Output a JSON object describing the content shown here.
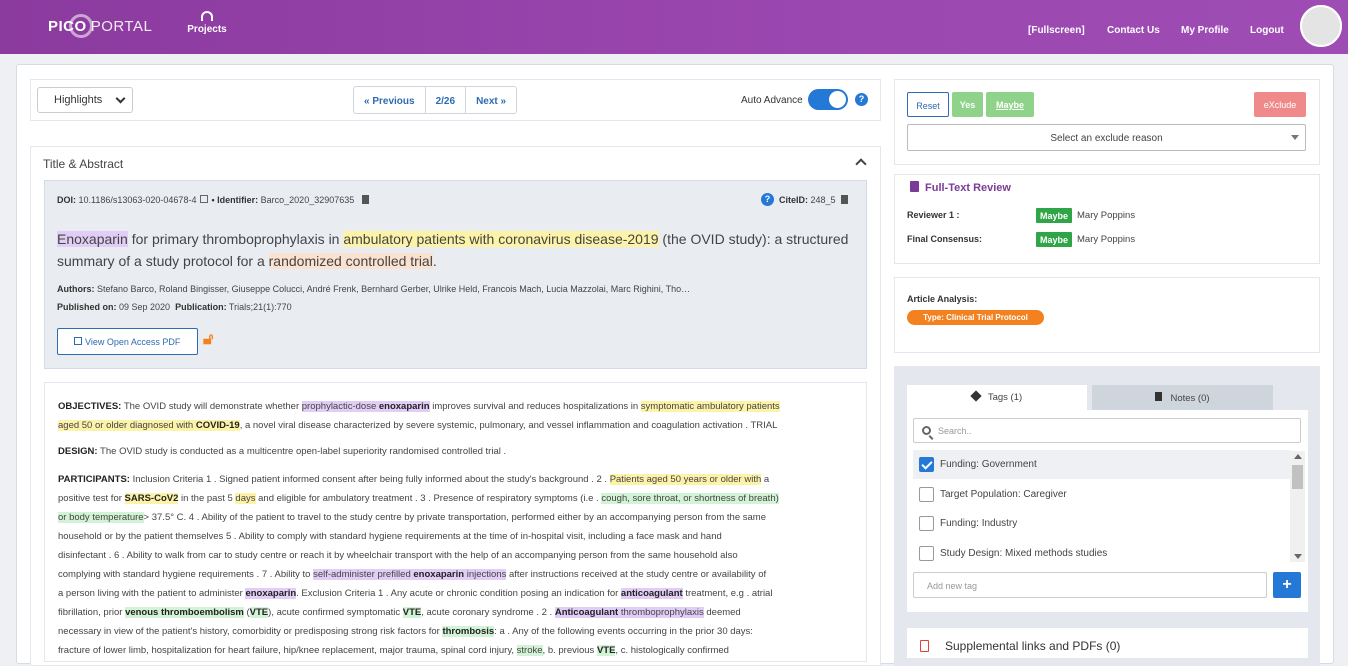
{
  "header": {
    "logo_bold": "PICO",
    "logo_light": "PORTAL",
    "projects": "Projects",
    "fullscreen": "[Fullscreen]",
    "contact": "Contact Us",
    "profile": "My Profile",
    "logout": "Logout"
  },
  "toolbar": {
    "view_select": "Highlights",
    "previous": "« Previous",
    "position": "2/26",
    "next": "Next »",
    "auto_advance": "Auto Advance"
  },
  "section": {
    "title": "Title & Abstract"
  },
  "meta": {
    "doi": "DOI:",
    "doi_value": "10.1186/s13063-020-04678-4",
    "identifier": "• Identifier:",
    "identifier_value": "Barco_2020_32907635",
    "cite_label": "CiteID:",
    "cite_value": "248_5",
    "authors_label": "Authors:",
    "authors": "Stefano Barco, Roland Bingisser, Giuseppe Colucci, André Frenk, Bernhard Gerber, Ulrike Held, Francois Mach, Lucia Mazzolai, Marc Righini, Tho…",
    "published_label": "Published on:",
    "published": "09 Sep 2020",
    "publication_label": "Publication:",
    "publication": "Trials;21(1):770",
    "pdf_button": "View Open Access PDF"
  },
  "title": {
    "t1": "Enoxaparin",
    "t2": " for primary thromboprophylaxis in ",
    "t3": "ambulatory patients",
    "t4": " with coronavirus disease-2019",
    "t5": " (the OVID study): a structured summary of a study protocol for a ",
    "t6": "randomized controlled trial",
    "t7": "."
  },
  "abstract": {
    "obj": {
      "label": "OBJECTIVES:",
      "a": " The OVID study will demonstrate whether ",
      "b": "prophylactic-dose ",
      "c": "enoxaparin",
      "d": " improves survival and reduces hospitalizations in ",
      "e": "symptomatic",
      "f": " ambulatory patients",
      "g": "aged 50 or older diagnosed with ",
      "h": "COVID-19",
      "i": ", a novel viral disease characterized by severe systemic, pulmonary, and vessel inflammation and coagulation activation . TRIAL"
    },
    "design": {
      "label": "DESIGN:",
      "text": " The OVID study is conducted as a multicentre open-label superiority randomised controlled trial ."
    },
    "part": {
      "label": "PARTICIPANTS:",
      "a": " Inclusion Criteria 1 . Signed patient informed consent after being fully informed about the study's background . 2 . ",
      "b": "Patients aged 50 years or older with",
      "c": " a",
      "d": "positive test for ",
      "e": "SARS-CoV2",
      "f": " in the past 5 ",
      "g": "days",
      "h": " and eligible for ambulatory treatment . 3 . Presence of respiratory symptoms (i.e . ",
      "i": "cough, sore throat, or shortness of breath)",
      "j": "or body temperature",
      "k": "> 37.5° C. 4 . Ability of the patient to travel to the study centre by private transportation, performed either by an accompanying person from the same",
      "l": "household or by the patient themselves 5 . Ability to comply with standard hygiene requirements at the time of in-hospital visit, including a face mask and hand",
      "m": "disinfectant . 6 . Ability to walk from car to study centre or reach it by wheelchair transport with the help of an accompanying person from the same household also",
      "n": "complying with standard hygiene requirements . 7 . Ability to ",
      "o": "self-administer prefilled ",
      "p": "enoxaparin",
      "q": " injections",
      "r": " after instructions received at the study centre or availability of",
      "s": "a person living with the patient to administer ",
      "t": "enoxaparin",
      "u": ". Exclusion Criteria 1 . Any acute or chronic condition posing an indication for ",
      "v": "anticoagulant",
      "w": " treatment, e.g . atrial",
      "x": "fibrillation, prior ",
      "y": "venous thromboembolism",
      "z": " (",
      "aa": "VTE",
      "ab": "), acute confirmed symptomatic ",
      "ac": "VTE",
      "ad": ", acute coronary syndrome . 2 . ",
      "ae": "Anticoagulant",
      "af": " thromboprophylaxis",
      "ag": " deemed",
      "ah": "necessary in view of the patient's history, comorbidity or predisposing strong risk factors for ",
      "ai": "thrombosis",
      "aj": ": a . Any of the following events occurring in the prior 30 days:",
      "ak": "fracture of lower limb, hospitalization for heart failure, hip/knee replacement, major trauma, spinal cord injury, ",
      "al": "stroke",
      "am": ", b. previous ",
      "an": "VTE",
      "ao": ", c. histologically confirmed"
    }
  },
  "decision": {
    "reset": "Reset",
    "yes": "Yes",
    "maybe": "Maybe",
    "exclude": "eXclude",
    "exclude_reason": "Select an exclude reason"
  },
  "fulltext": {
    "title": "Full-Text Review",
    "reviewer_label": "Reviewer 1 :",
    "reviewer_status": "Maybe",
    "reviewer_name": "Mary Poppins",
    "consensus_label": "Final Consensus:",
    "consensus_status": "Maybe",
    "consensus_name": "Mary Poppins"
  },
  "analysis": {
    "label": "Article Analysis:",
    "type": "Type: Clinical Trial Protocol"
  },
  "tags": {
    "tab_tags": "Tags (1)",
    "tab_notes": "Notes (0)",
    "search_placeholder": "Search..",
    "items": [
      {
        "label": "Funding: Government",
        "checked": true
      },
      {
        "label": "Target Population: Caregiver",
        "checked": false
      },
      {
        "label": "Funding: Industry",
        "checked": false
      },
      {
        "label": "Study Design: Mixed methods studies",
        "checked": false
      }
    ],
    "new_placeholder": "Add new tag",
    "add": "+"
  },
  "supplemental": {
    "title": "Supplemental links and PDFs (0)"
  },
  "colors": {
    "brand": "#9b47b0",
    "accent": "#2478d6",
    "maybe": "#2fa548",
    "type_badge": "#f48120"
  }
}
